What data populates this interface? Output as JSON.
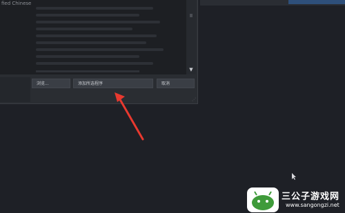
{
  "dialog": {
    "language_label": "fied Chinese",
    "buttons": {
      "browse": "浏览...",
      "add_selected": "添加所选程序",
      "cancel": "取消"
    }
  },
  "annotation": {
    "arrow_color": "#e8392f"
  },
  "watermark": {
    "title": "三公子游戏网",
    "url": "www.sangongzi.net"
  }
}
